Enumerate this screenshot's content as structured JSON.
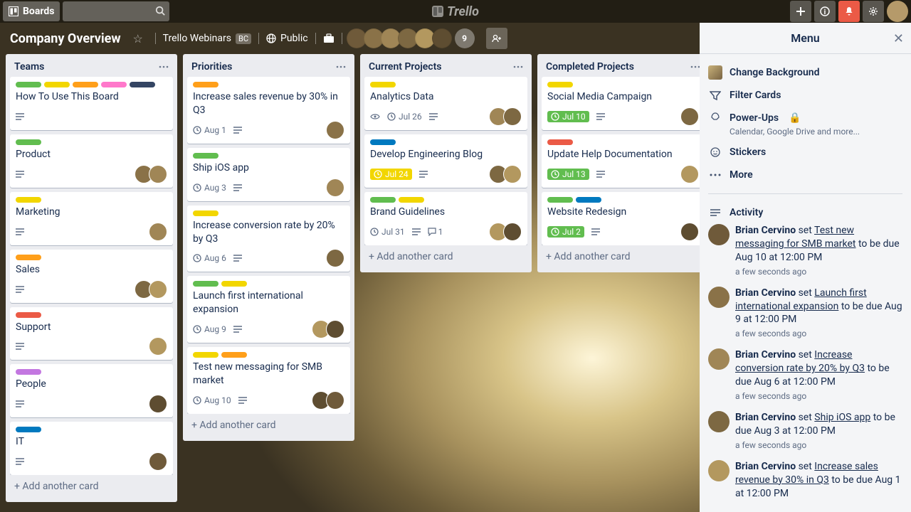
{
  "header": {
    "boards": "Boards",
    "logo": "Trello"
  },
  "board": {
    "name": "Company Overview",
    "team": "Trello Webinars",
    "team_badge": "BC",
    "visibility": "Public",
    "member_overflow": "9"
  },
  "lists": [
    {
      "title": "Teams",
      "cards": [
        {
          "labels": [
            "green",
            "yellow",
            "orange",
            "pink",
            "black"
          ],
          "title": "How To Use This Board",
          "desc": true
        },
        {
          "labels": [
            "green"
          ],
          "title": "Product",
          "desc": true,
          "members": 2
        },
        {
          "labels": [
            "yellow"
          ],
          "title": "Marketing",
          "desc": true,
          "members": 1
        },
        {
          "labels": [
            "orange"
          ],
          "title": "Sales",
          "desc": true,
          "members": 2
        },
        {
          "labels": [
            "red"
          ],
          "title": "Support",
          "desc": true,
          "members": 1
        },
        {
          "labels": [
            "purple"
          ],
          "title": "People",
          "desc": true,
          "members": 1
        },
        {
          "labels": [
            "blue"
          ],
          "title": "IT",
          "desc": true,
          "members": 1
        }
      ],
      "add": "Add another card"
    },
    {
      "title": "Priorities",
      "cards": [
        {
          "labels": [
            "orange"
          ],
          "title": "Increase sales revenue by 30% in Q3",
          "due": "Aug 1",
          "desc": true,
          "members": 1
        },
        {
          "labels": [
            "green"
          ],
          "title": "Ship iOS app",
          "due": "Aug 3",
          "desc": true,
          "members": 1
        },
        {
          "labels": [
            "yellow"
          ],
          "title": "Increase conversion rate by 20% by Q3",
          "due": "Aug 6",
          "desc": true,
          "members": 1
        },
        {
          "labels": [
            "green",
            "yellow"
          ],
          "title": "Launch first international expansion",
          "due": "Aug 9",
          "desc": true,
          "members": 2
        },
        {
          "labels": [
            "yellow",
            "orange"
          ],
          "title": "Test new messaging for SMB market",
          "due": "Aug 10",
          "desc": true,
          "members": 2
        }
      ],
      "add": "Add another card"
    },
    {
      "title": "Current Projects",
      "cards": [
        {
          "labels": [
            "yellow"
          ],
          "title": "Analytics Data",
          "watch": true,
          "due": "Jul 26",
          "desc": true,
          "members": 2
        },
        {
          "labels": [
            "blue"
          ],
          "title": "Develop Engineering Blog",
          "due": "Jul 24",
          "due_style": "soon",
          "desc": true,
          "members": 2
        },
        {
          "labels": [
            "green",
            "yellow"
          ],
          "title": "Brand Guidelines",
          "due": "Jul 31",
          "desc": true,
          "comments": "1",
          "members": 2
        }
      ],
      "add": "Add another card"
    },
    {
      "title": "Completed Projects",
      "cards": [
        {
          "labels": [
            "yellow"
          ],
          "title": "Social Media Campaign",
          "due": "Jul 10",
          "due_style": "done",
          "desc": true,
          "members": 1
        },
        {
          "labels": [
            "red"
          ],
          "title": "Update Help Documentation",
          "due": "Jul 13",
          "due_style": "done",
          "desc": true,
          "members": 1
        },
        {
          "labels": [
            "green",
            "blue"
          ],
          "title": "Website Redesign",
          "due": "Jul 2",
          "due_style": "done",
          "desc": true,
          "members": 1
        }
      ],
      "add": "Add another card"
    }
  ],
  "menu": {
    "title": "Menu",
    "change_bg": "Change Background",
    "filter": "Filter Cards",
    "powerups": "Power-Ups",
    "powerups_sub": "Calendar, Google Drive and more...",
    "stickers": "Stickers",
    "more": "More",
    "activity_title": "Activity",
    "activity": [
      {
        "user": "Brian Cervino",
        "verb": "set",
        "link": "Test new messaging for SMB market",
        "rest": "to be due Aug 10 at 12:00 PM",
        "time": "a few seconds ago"
      },
      {
        "user": "Brian Cervino",
        "verb": "set",
        "link": "Launch first international expansion",
        "rest": "to be due Aug 9 at 12:00 PM",
        "time": "a few seconds ago"
      },
      {
        "user": "Brian Cervino",
        "verb": "set",
        "link": "Increase conversion rate by 20% by Q3",
        "rest": "to be due Aug 6 at 12:00 PM",
        "time": "a few seconds ago"
      },
      {
        "user": "Brian Cervino",
        "verb": "set",
        "link": "Ship iOS app",
        "rest": "to be due Aug 3 at 12:00 PM",
        "time": "a few seconds ago"
      },
      {
        "user": "Brian Cervino",
        "verb": "set",
        "link": "Increase sales revenue by 30% in Q3",
        "rest": "to be due Aug 1 at 12:00 PM",
        "time": ""
      }
    ]
  }
}
